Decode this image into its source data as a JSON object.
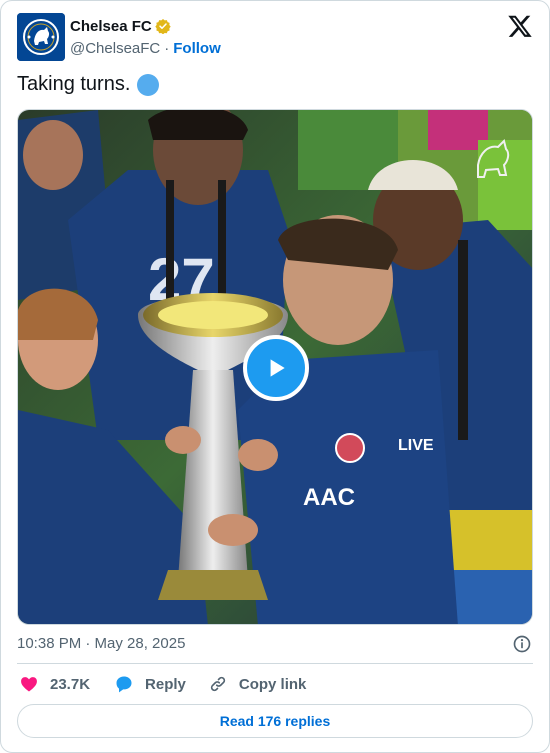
{
  "author": {
    "display_name": "Chelsea FC",
    "handle": "@ChelseaFC",
    "separator": "·",
    "follow_label": "Follow",
    "verified_color": "#e2b719"
  },
  "tweet": {
    "text": "Taking turns.",
    "emoji": "blue-circle",
    "timestamp": "10:38 PM · May 28, 2025"
  },
  "media": {
    "type": "video",
    "play_color": "#1d9bf0"
  },
  "actions": {
    "like_count": "23.7K",
    "reply_label": "Reply",
    "copy_label": "Copy link",
    "like_color": "#f91880",
    "reply_color": "#1d9bf0"
  },
  "footer": {
    "read_replies_label": "Read 176 replies"
  }
}
